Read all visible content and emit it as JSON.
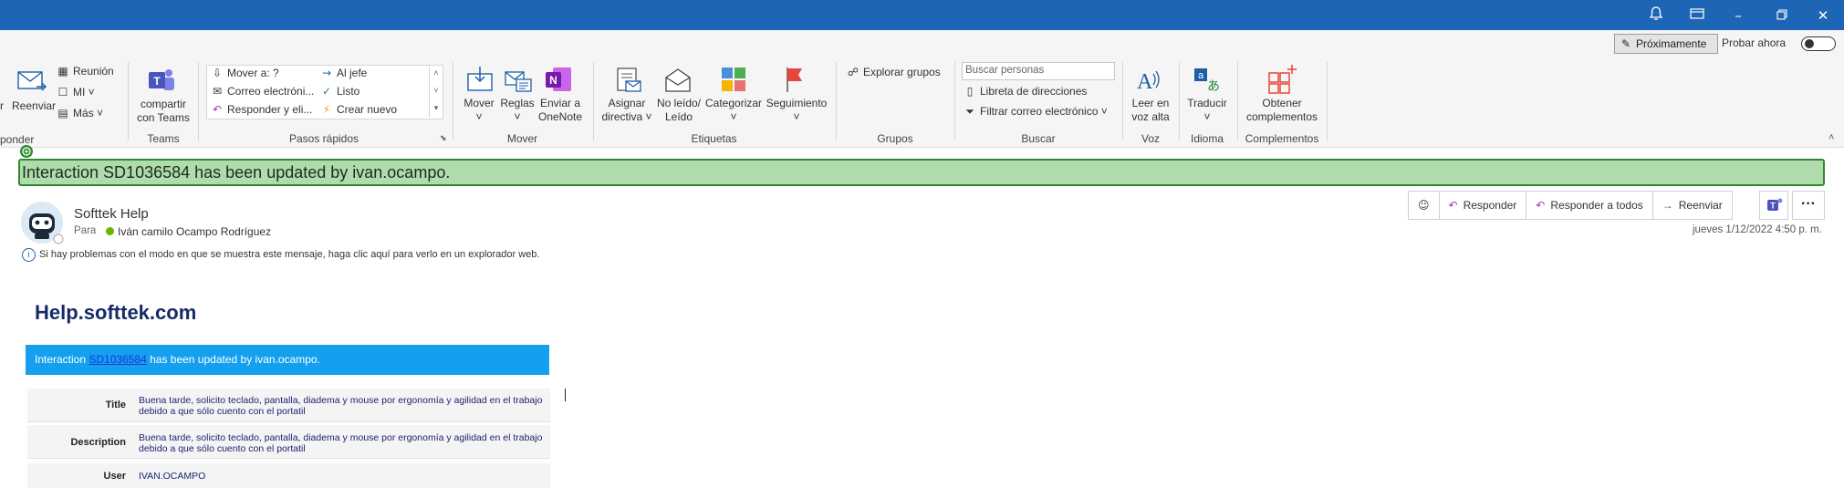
{
  "ribbon": {
    "respond_partial": "ponder",
    "respond_partial_left": "r",
    "forward_label": "Reenviar",
    "meeting_label": "Reunión",
    "im_label": "MI",
    "more_label": "Más",
    "teams_share_label_1": "compartir",
    "teams_share_label_2": "con Teams",
    "teams_group": "Teams",
    "quicksteps": [
      "Mover a: ?",
      "Correo electróni...",
      "Responder y eli...",
      "Al jefe",
      "Listo",
      "Crear nuevo"
    ],
    "quicksteps_group": "Pasos rápidos",
    "move_label": "Mover",
    "rules_label": "Reglas",
    "onenote_label_1": "Enviar a",
    "onenote_label_2": "OneNote",
    "move_group": "Mover",
    "assign_label_1": "Asignar",
    "assign_label_2": "directiva",
    "unread_label_1": "No leído/",
    "unread_label_2": "Leído",
    "categorize_label": "Categorizar",
    "followup_label": "Seguimiento",
    "tags_group": "Etiquetas",
    "explore_groups_label": "Explorar grupos",
    "groups_group": "Grupos",
    "search_people_placeholder": "Buscar personas",
    "address_book_label": "Libreta de direcciones",
    "filter_mail_label": "Filtrar correo electrónico",
    "search_group": "Buscar",
    "read_aloud_label_1": "Leer en",
    "read_aloud_label_2": "voz alta",
    "voice_group": "Voz",
    "translate_label": "Traducir",
    "language_group": "Idioma",
    "addins_label_1": "Obtener",
    "addins_label_2": "complementos",
    "addins_group": "Complementos",
    "coming_soon_label": "Próximamente",
    "try_now_label": "Probar ahora"
  },
  "banner_text": "Interaction SD1036584 has been updated by ivan.ocampo.",
  "message": {
    "sender": "Softtek Help",
    "to_label": "Para",
    "recipient": "Iván camilo Ocampo Rodríguez",
    "info_text": "Si hay problemas con el modo en que se muestra este mensaje, haga clic aquí para verlo en un explorador web.",
    "date": "jueves 1/12/2022 4:50 p. m.",
    "actions": {
      "reply": "Responder",
      "reply_all": "Responder a todos",
      "forward": "Reenviar"
    }
  },
  "body": {
    "site_title": "Help.softtek.com",
    "bar_prefix": "Interaction ",
    "bar_link": "SD1036584",
    "bar_suffix": " has been updated by ivan.ocampo.",
    "rows": [
      {
        "key": "Title",
        "value": "Buena tarde, solicito teclado, pantalla, diadema y mouse por ergonomía y agilidad en el trabajo debido a que sólo cuento con el portatil"
      },
      {
        "key": "Description",
        "value": "Buena tarde, solicito teclado, pantalla, diadema y mouse por ergonomía y agilidad en el trabajo debido a que sólo cuento con el portatil"
      },
      {
        "key": "User",
        "value": "IVAN.OCAMPO"
      }
    ]
  },
  "colors": {
    "titlebar": "#1d66b5",
    "banner_bg": "#afdbad",
    "banner_border": "#2f8a2f",
    "blue_bar": "#14a0ee",
    "site_title": "#172a66"
  }
}
